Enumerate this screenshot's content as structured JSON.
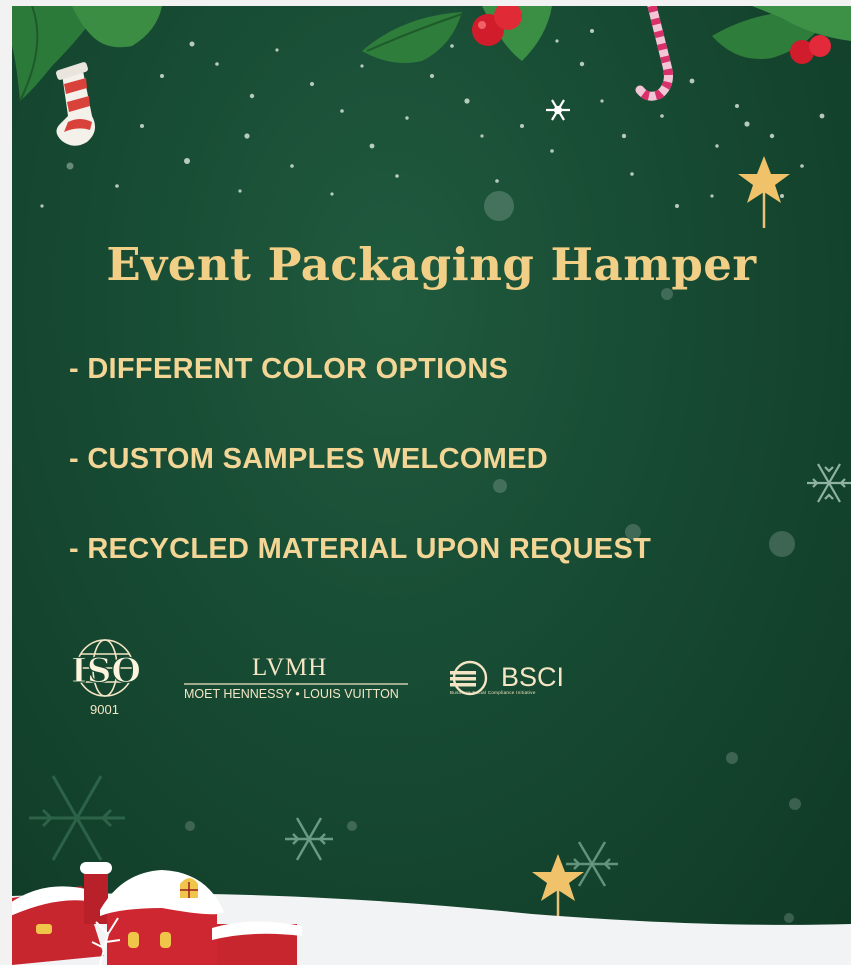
{
  "title": "Event Packaging Hamper",
  "features": [
    "- DIFFERENT COLOR OPTIONS",
    "- CUSTOM SAMPLES WELCOMED",
    "- RECYCLED MATERIAL UPON REQUEST"
  ],
  "logos": {
    "iso_mark": "ISO",
    "iso_number": "9001",
    "lvmh_main": "LVMH",
    "lvmh_sub": "MOET HENNESSY • LOUIS VUITTON",
    "bsci_text": "BSCI",
    "bsci_sub": "Business Social Compliance Initiative"
  },
  "colors": {
    "background": "#174a33",
    "title_gold": "#f1cf86",
    "feature_gold": "#f3d596",
    "holly_leaf": "#2f7a3a",
    "berry_red": "#d01c2b",
    "snow": "#ffffff"
  }
}
